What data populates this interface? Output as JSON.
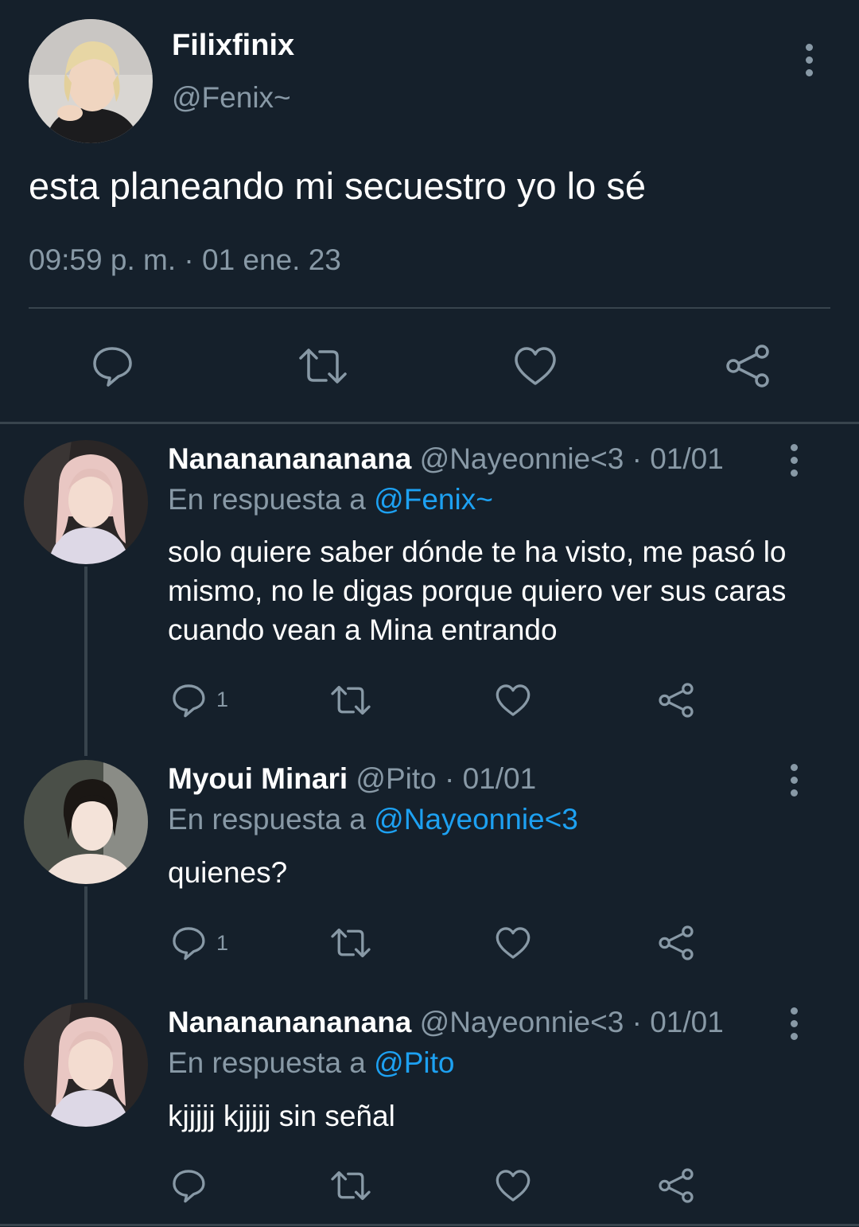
{
  "main_tweet": {
    "display_name": "Filixfinix",
    "handle": "@Fenix~",
    "text": "esta planeando mi secuestro yo lo sé",
    "timestamp": "09:59 p. m. · 01 ene. 23",
    "avatar_icon": "profile-photo-blond-man",
    "actions": [
      "reply-icon",
      "retweet-icon",
      "like-icon",
      "share-icon"
    ]
  },
  "replies": [
    {
      "display_name": "Nanananananana",
      "handle_date": "@Nayeonnie<3 · 01/01",
      "reply_prefix": "En respuesta a",
      "reply_to": "@Fenix~",
      "text": "solo quiere saber dónde te ha visto, me pasó lo mismo, no le digas porque quiero ver sus caras cuando vean a Mina entrando",
      "reply_count": "1"
    },
    {
      "display_name": "Myoui Minari",
      "handle_date": "@Pito · 01/01",
      "reply_prefix": "En respuesta a",
      "reply_to": "@Nayeonnie<3",
      "text": "quienes?",
      "reply_count": "1"
    },
    {
      "display_name": "Nanananananana",
      "handle_date": "@Nayeonnie<3 · 01/01",
      "reply_prefix": "En respuesta a",
      "reply_to": "@Pito",
      "text": "kjjjjj kjjjjj sin señal",
      "reply_count": ""
    }
  ],
  "colors": {
    "background": "#15202b",
    "secondary_text": "#8899a6",
    "mention": "#1da1f2",
    "divider": "#38444d"
  }
}
